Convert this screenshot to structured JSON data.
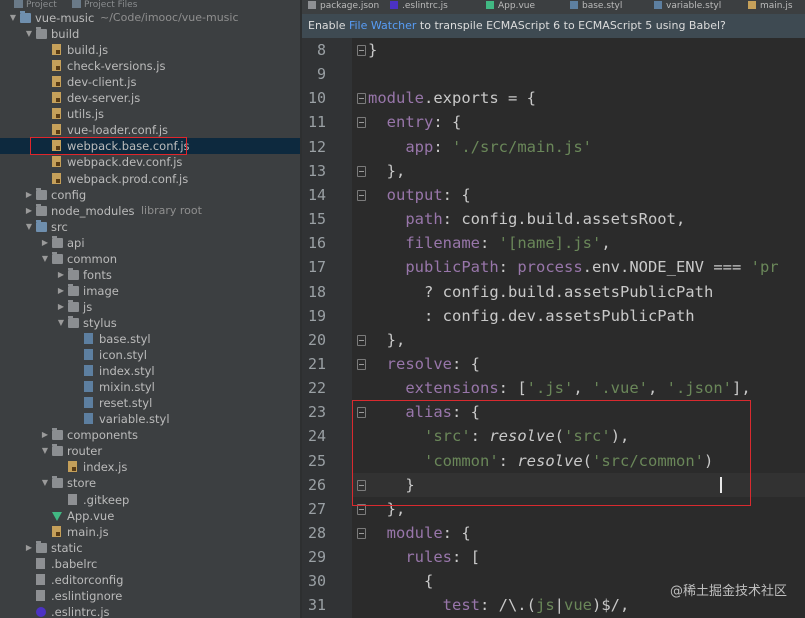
{
  "project_tabs": [
    "Project",
    "Project Files"
  ],
  "tree": [
    {
      "label": "vue-music",
      "hint": "~/Code/imooc/vue-music",
      "type": "folder-blue",
      "depth": 0,
      "open": true
    },
    {
      "label": "build",
      "type": "folder",
      "depth": 1,
      "open": true
    },
    {
      "label": "build.js",
      "type": "js",
      "depth": 2
    },
    {
      "label": "check-versions.js",
      "type": "js",
      "depth": 2
    },
    {
      "label": "dev-client.js",
      "type": "js",
      "depth": 2
    },
    {
      "label": "dev-server.js",
      "type": "js",
      "depth": 2
    },
    {
      "label": "utils.js",
      "type": "js",
      "depth": 2
    },
    {
      "label": "vue-loader.conf.js",
      "type": "js",
      "depth": 2
    },
    {
      "label": "webpack.base.conf.js",
      "type": "js",
      "depth": 2,
      "selected": true
    },
    {
      "label": "webpack.dev.conf.js",
      "type": "js",
      "depth": 2
    },
    {
      "label": "webpack.prod.conf.js",
      "type": "js",
      "depth": 2
    },
    {
      "label": "config",
      "type": "folder",
      "depth": 1,
      "open": false
    },
    {
      "label": "node_modules",
      "hint": "library root",
      "type": "folder",
      "depth": 1,
      "open": false
    },
    {
      "label": "src",
      "type": "folder-blue",
      "depth": 1,
      "open": true
    },
    {
      "label": "api",
      "type": "folder",
      "depth": 2,
      "open": false
    },
    {
      "label": "common",
      "type": "folder",
      "depth": 2,
      "open": true
    },
    {
      "label": "fonts",
      "type": "folder",
      "depth": 3,
      "open": false
    },
    {
      "label": "image",
      "type": "folder",
      "depth": 3,
      "open": false
    },
    {
      "label": "js",
      "type": "folder",
      "depth": 3,
      "open": false
    },
    {
      "label": "stylus",
      "type": "folder",
      "depth": 3,
      "open": true
    },
    {
      "label": "base.styl",
      "type": "styl",
      "depth": 4
    },
    {
      "label": "icon.styl",
      "type": "styl",
      "depth": 4
    },
    {
      "label": "index.styl",
      "type": "styl",
      "depth": 4
    },
    {
      "label": "mixin.styl",
      "type": "styl",
      "depth": 4
    },
    {
      "label": "reset.styl",
      "type": "styl",
      "depth": 4
    },
    {
      "label": "variable.styl",
      "type": "styl",
      "depth": 4
    },
    {
      "label": "components",
      "type": "folder",
      "depth": 2,
      "open": false
    },
    {
      "label": "router",
      "type": "folder",
      "depth": 2,
      "open": true
    },
    {
      "label": "index.js",
      "type": "js",
      "depth": 3
    },
    {
      "label": "store",
      "type": "folder",
      "depth": 2,
      "open": true
    },
    {
      "label": ".gitkeep",
      "type": "cfg",
      "depth": 3
    },
    {
      "label": "App.vue",
      "type": "vue",
      "depth": 2
    },
    {
      "label": "main.js",
      "type": "js",
      "depth": 2
    },
    {
      "label": "static",
      "type": "folder",
      "depth": 1,
      "open": false
    },
    {
      "label": ".babelrc",
      "type": "cfg",
      "depth": 1
    },
    {
      "label": ".editorconfig",
      "type": "cfg",
      "depth": 1
    },
    {
      "label": ".eslintignore",
      "type": "cfg",
      "depth": 1
    },
    {
      "label": ".eslintrc.js",
      "type": "eslint",
      "depth": 1
    }
  ],
  "editor_tabs": [
    {
      "label": "package.json",
      "color": "#8e9093"
    },
    {
      "label": ".eslintrc.js",
      "color": "#4b32c3"
    },
    {
      "label": "App.vue",
      "color": "#41b883"
    },
    {
      "label": "base.styl",
      "color": "#5d7fa0"
    },
    {
      "label": "variable.styl",
      "color": "#5d7fa0"
    },
    {
      "label": "main.js",
      "color": "#c5a05a"
    }
  ],
  "notification": {
    "pre": "Enable ",
    "link": "File Watcher",
    "post": " to transpile ECMAScript 6 to ECMAScript 5 using Babel?"
  },
  "code": {
    "line_numbers": [
      "8",
      "9",
      "10",
      "11",
      "12",
      "13",
      "14",
      "15",
      "16",
      "17",
      "18",
      "19",
      "20",
      "21",
      "22",
      "23",
      "24",
      "25",
      "26",
      "27",
      "28",
      "29",
      "30",
      "31"
    ],
    "lines": [
      [
        [
          "}",
          ""
        ]
      ],
      [],
      [
        [
          "module",
          "p"
        ],
        [
          ".exports = {",
          ""
        ]
      ],
      [
        [
          "  entry",
          "p"
        ],
        [
          ": {",
          ""
        ]
      ],
      [
        [
          "    app",
          "p"
        ],
        [
          ": ",
          ""
        ],
        [
          "'./src/main.js'",
          "s"
        ]
      ],
      [
        [
          "  },",
          ""
        ]
      ],
      [
        [
          "  output",
          "p"
        ],
        [
          ": {",
          ""
        ]
      ],
      [
        [
          "    path",
          "p"
        ],
        [
          ": config.build.assetsRoot,",
          ""
        ]
      ],
      [
        [
          "    filename",
          "p"
        ],
        [
          ": ",
          ""
        ],
        [
          "'[name].js'",
          "s"
        ],
        [
          ",",
          ""
        ]
      ],
      [
        [
          "    publicPath",
          "p"
        ],
        [
          ": ",
          ""
        ],
        [
          "process",
          "p"
        ],
        [
          ".env.NODE_ENV ",
          ""
        ],
        [
          "=== ",
          ""
        ],
        [
          "'pr",
          "s"
        ]
      ],
      [
        [
          "      ? config.build.assetsPublicPath",
          ""
        ]
      ],
      [
        [
          "      : config.dev.assetsPublicPath",
          ""
        ]
      ],
      [
        [
          "  },",
          ""
        ]
      ],
      [
        [
          "  resolve",
          "p"
        ],
        [
          ": {",
          ""
        ]
      ],
      [
        [
          "    extensions",
          "p"
        ],
        [
          ": [",
          ""
        ],
        [
          "'.js'",
          "s"
        ],
        [
          ", ",
          ""
        ],
        [
          "'.vue'",
          "s"
        ],
        [
          ", ",
          ""
        ],
        [
          "'.json'",
          "s"
        ],
        [
          "],",
          ""
        ]
      ],
      [
        [
          "    alias",
          "p"
        ],
        [
          ": {",
          ""
        ]
      ],
      [
        [
          "      ",
          ""
        ],
        [
          "'src'",
          "s"
        ],
        [
          ": ",
          ""
        ],
        [
          "resolve",
          "f"
        ],
        [
          "(",
          ""
        ],
        [
          "'src'",
          "s"
        ],
        [
          "),",
          ""
        ]
      ],
      [
        [
          "      ",
          ""
        ],
        [
          "'common'",
          "s"
        ],
        [
          ": ",
          ""
        ],
        [
          "resolve",
          "f"
        ],
        [
          "(",
          ""
        ],
        [
          "'src/common'",
          "s"
        ],
        [
          ")",
          ""
        ]
      ],
      [
        [
          "    }",
          ""
        ]
      ],
      [
        [
          "  },",
          ""
        ]
      ],
      [
        [
          "  module",
          "p"
        ],
        [
          ": {",
          ""
        ]
      ],
      [
        [
          "    rules",
          "p"
        ],
        [
          ": [",
          ""
        ]
      ],
      [
        [
          "      {",
          ""
        ]
      ],
      [
        [
          "        test",
          "p"
        ],
        [
          ": /\\.(",
          ""
        ],
        [
          "js",
          "r"
        ],
        [
          "|",
          ""
        ],
        [
          "vue",
          "r"
        ],
        [
          ")$/,",
          ""
        ]
      ]
    ]
  },
  "watermark": "@稀土掘金技术社区"
}
